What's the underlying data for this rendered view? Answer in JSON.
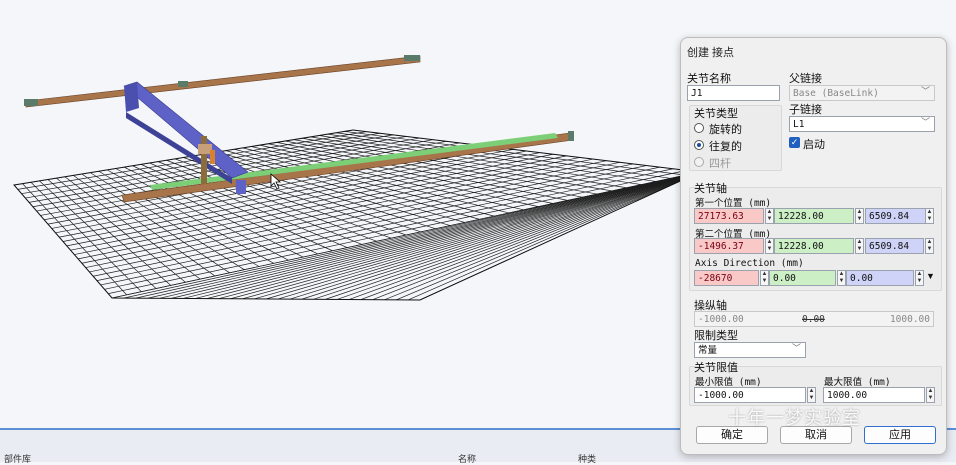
{
  "dialog": {
    "title": "创建 接点",
    "joint_name_label": "关节名称",
    "joint_name_value": "J1",
    "parent_link_label": "父链接",
    "parent_link_value": "Base (BaseLink)",
    "child_link_label": "子链接",
    "child_link_value": "L1",
    "enabled_label": "启动",
    "joint_type_label": "关节类型",
    "joint_types": [
      "旋转的",
      "往复的",
      "四杆"
    ],
    "axis_label": "关节轴",
    "first_pos_label": "第一个位置 (mm)",
    "first_pos": [
      "27173.63",
      "12228.00",
      "6509.84"
    ],
    "second_pos_label": "第二个位置 (mm)",
    "second_pos": [
      "-1496.37",
      "12228.00",
      "6509.84"
    ],
    "axis_dir_label": "Axis Direction (mm)",
    "axis_dir": [
      "-28670",
      "0.00",
      "0.00"
    ],
    "jog_label": "操纵轴",
    "jog_min": "-1000.00",
    "jog_value": "0.00",
    "jog_max": "1000.00",
    "limit_type_label": "限制类型",
    "limit_type_value": "常量",
    "joint_limits_label": "关节限值",
    "min_limit_label": "最小限值 (mm)",
    "min_limit_value": "-1000.00",
    "max_limit_label": "最大限值 (mm)",
    "max_limit_value": "1000.00",
    "ok_label": "确定",
    "cancel_label": "取消",
    "apply_label": "应用"
  },
  "watermark": "十年一梦实验室",
  "bottom_strip": [
    "部件库",
    "名称",
    "种类"
  ],
  "colors": {
    "accent": "#2f6fd1",
    "rail": "#a8744a",
    "beam": "#5e62c7",
    "grid": "#1e1e1e"
  },
  "icons": [
    "dropdown-chevron-icon",
    "checkbox-checked-icon",
    "spin-arrows-icon",
    "mouse-cursor-icon"
  ]
}
